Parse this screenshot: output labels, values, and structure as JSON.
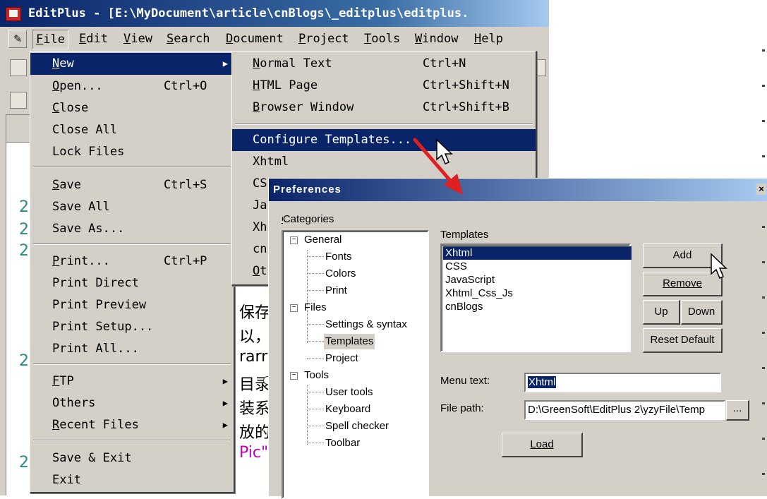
{
  "window": {
    "title": "EditPlus - [E:\\MyDocument\\article\\cnBlogs\\_editplus\\editplus."
  },
  "menubar": {
    "items": [
      "File",
      "Edit",
      "View",
      "Search",
      "Document",
      "Project",
      "Tools",
      "Window",
      "Help"
    ]
  },
  "file_menu": {
    "items": [
      {
        "label": "New",
        "shortcut": "",
        "submenu": true
      },
      {
        "label": "Open...",
        "shortcut": "Ctrl+O"
      },
      {
        "label": "Close",
        "shortcut": ""
      },
      {
        "label": "Close All",
        "shortcut": ""
      },
      {
        "label": "Lock Files",
        "shortcut": ""
      },
      {
        "label": "Save",
        "shortcut": "Ctrl+S"
      },
      {
        "label": "Save All",
        "shortcut": ""
      },
      {
        "label": "Save As...",
        "shortcut": ""
      },
      {
        "label": "Print...",
        "shortcut": "Ctrl+P"
      },
      {
        "label": "Print Direct",
        "shortcut": ""
      },
      {
        "label": "Print Preview",
        "shortcut": ""
      },
      {
        "label": "Print Setup...",
        "shortcut": ""
      },
      {
        "label": "Print All...",
        "shortcut": ""
      },
      {
        "label": "FTP",
        "shortcut": "",
        "submenu": true
      },
      {
        "label": "Others",
        "shortcut": "",
        "submenu": true
      },
      {
        "label": "Recent Files",
        "shortcut": "",
        "submenu": true
      },
      {
        "label": "Save & Exit",
        "shortcut": ""
      },
      {
        "label": "Exit",
        "shortcut": ""
      }
    ]
  },
  "new_menu": {
    "items": [
      {
        "label": "Normal Text",
        "shortcut": "Ctrl+N"
      },
      {
        "label": "HTML Page",
        "shortcut": "Ctrl+Shift+N"
      },
      {
        "label": "Browser Window",
        "shortcut": "Ctrl+Shift+B"
      },
      {
        "label": "Configure Templates...",
        "shortcut": ""
      },
      {
        "label": "Xhtml",
        "shortcut": ""
      },
      {
        "label": "CS",
        "shortcut": ""
      },
      {
        "label": "Ja",
        "shortcut": ""
      },
      {
        "label": "Xh",
        "shortcut": ""
      },
      {
        "label": "cn",
        "shortcut": ""
      },
      {
        "label": "Ot",
        "shortcut": ""
      }
    ]
  },
  "editor": {
    "line_numbers": [
      "2",
      "2",
      "2",
      "2",
      "2"
    ],
    "cjk_fragments": [
      "保存",
      "以，",
      "rarr",
      "目录",
      "装系",
      "放的",
      "Pic\""
    ]
  },
  "preferences": {
    "title": "Preferences",
    "categories_label": "Categories",
    "categories": {
      "general": "General",
      "fonts": "Fonts",
      "colors": "Colors",
      "print": "Print",
      "files": "Files",
      "settings_syntax": "Settings & syntax",
      "templates": "Templates",
      "project": "Project",
      "tools": "Tools",
      "user_tools": "User tools",
      "keyboard": "Keyboard",
      "spell_checker": "Spell checker",
      "toolbar": "Toolbar"
    },
    "templates_label": "Templates",
    "templates": [
      "Xhtml",
      "CSS",
      "JavaScript",
      "Xhtml_Css_Js",
      "cnBlogs"
    ],
    "buttons": {
      "add": "Add",
      "remove": "Remove",
      "up": "Up",
      "down": "Down",
      "reset_default": "Reset Default",
      "load": "Load",
      "browse": "..."
    },
    "menu_text_label": "Menu text:",
    "menu_text_value": "Xhtml",
    "file_path_label": "File path:",
    "file_path_value": "D:\\GreenSoft\\EditPlus 2\\yzyFile\\Temp"
  },
  "colors": {
    "menu_highlight": "#0a246a",
    "face": "#d4d0c8",
    "annotation_arrow": "#e02020"
  },
  "icons": [
    "app-icon",
    "pencil-icon",
    "submenu-arrow-icon",
    "mouse-pointer-icon",
    "close-icon",
    "annotation-arrow-icon"
  ]
}
